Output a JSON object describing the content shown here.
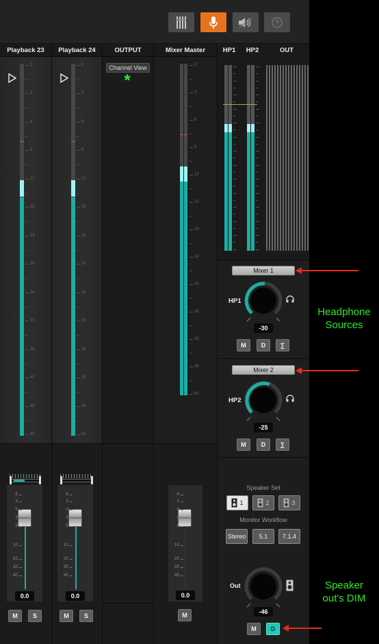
{
  "toolbar": {
    "buttons": [
      {
        "icon": "mixer-bars-icon",
        "active": false
      },
      {
        "icon": "microphone-icon",
        "active": true
      },
      {
        "icon": "speaker-mute-icon",
        "active": false
      },
      {
        "icon": "help-icon",
        "active": false
      }
    ],
    "help_label": "?"
  },
  "channels": {
    "pb23": {
      "name": "Playback 23",
      "value": "0.0",
      "mute": "M",
      "solo": "S"
    },
    "pb24": {
      "name": "Playback 24",
      "value": "0.0",
      "mute": "M",
      "solo": "S"
    },
    "output": {
      "name": "OUTPUT",
      "channel_view": "Channel View",
      "asterisk": "*"
    },
    "master": {
      "name": "Mixer Master",
      "value": "0.0",
      "mute": "M"
    }
  },
  "meter_scale": [
    "0",
    "3",
    "6",
    "9",
    "12",
    "15",
    "18",
    "20",
    "24",
    "30",
    "36",
    "42",
    "48",
    "60"
  ],
  "master_scale": [
    "0",
    "3",
    "6",
    "9",
    "12",
    "15",
    "20",
    "24",
    "30",
    "36",
    "42",
    "48",
    "60"
  ],
  "small_meter_scale": [
    "0",
    "3",
    "6",
    "9",
    "12",
    "15",
    "18",
    "20",
    "24",
    "30",
    "36",
    "42",
    "48",
    "60"
  ],
  "fader_scale": [
    "6",
    "3",
    "0",
    "3",
    "5",
    "10",
    "20",
    "30",
    "40"
  ],
  "outputs": {
    "hp1": "HP1",
    "hp2": "HP2",
    "out": "OUT"
  },
  "hp1": {
    "source": "Mixer 1",
    "label": "HP1",
    "value": "-30",
    "m": "M",
    "d": "D",
    "sum": "∑",
    "level": 0.62
  },
  "hp2": {
    "source": "Mixer 2",
    "label": "HP2",
    "value": "-25",
    "m": "M",
    "d": "D",
    "sum": "∑",
    "level": 0.68
  },
  "monitor": {
    "speaker_set_label": "Speaker Set",
    "speaker_sets": [
      "1",
      "2",
      "3"
    ],
    "workflow_label": "Monitor Workflow",
    "workflows": [
      "Stereo",
      "5.1",
      "7.1.4"
    ],
    "out_label": "Out",
    "out_value": "-46",
    "m": "M",
    "d": "D"
  },
  "annotations": {
    "headphone": "Headphone Sources",
    "speaker": "Speaker out's DIM"
  },
  "colors": {
    "accent": "#e8731f",
    "meter": "#1aafa5",
    "meter_hi": "#9ef3f6",
    "annotation": "#2ee82e",
    "arrow": "#e52d1c"
  }
}
